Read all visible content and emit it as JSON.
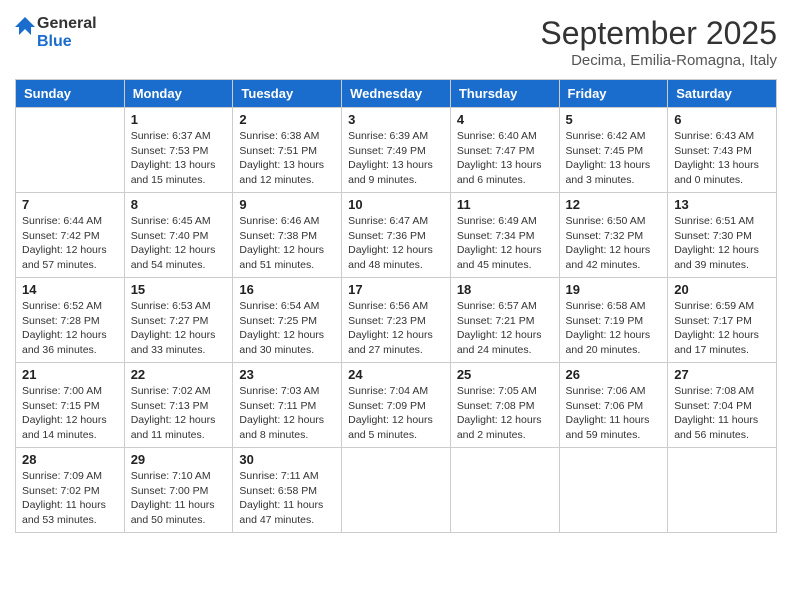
{
  "header": {
    "logo_line1": "General",
    "logo_line2": "Blue",
    "title": "September 2025",
    "subtitle": "Decima, Emilia-Romagna, Italy"
  },
  "days_of_week": [
    "Sunday",
    "Monday",
    "Tuesday",
    "Wednesday",
    "Thursday",
    "Friday",
    "Saturday"
  ],
  "weeks": [
    [
      {
        "day": "",
        "lines": []
      },
      {
        "day": "1",
        "lines": [
          "Sunrise: 6:37 AM",
          "Sunset: 7:53 PM",
          "Daylight: 13 hours",
          "and 15 minutes."
        ]
      },
      {
        "day": "2",
        "lines": [
          "Sunrise: 6:38 AM",
          "Sunset: 7:51 PM",
          "Daylight: 13 hours",
          "and 12 minutes."
        ]
      },
      {
        "day": "3",
        "lines": [
          "Sunrise: 6:39 AM",
          "Sunset: 7:49 PM",
          "Daylight: 13 hours",
          "and 9 minutes."
        ]
      },
      {
        "day": "4",
        "lines": [
          "Sunrise: 6:40 AM",
          "Sunset: 7:47 PM",
          "Daylight: 13 hours",
          "and 6 minutes."
        ]
      },
      {
        "day": "5",
        "lines": [
          "Sunrise: 6:42 AM",
          "Sunset: 7:45 PM",
          "Daylight: 13 hours",
          "and 3 minutes."
        ]
      },
      {
        "day": "6",
        "lines": [
          "Sunrise: 6:43 AM",
          "Sunset: 7:43 PM",
          "Daylight: 13 hours",
          "and 0 minutes."
        ]
      }
    ],
    [
      {
        "day": "7",
        "lines": [
          "Sunrise: 6:44 AM",
          "Sunset: 7:42 PM",
          "Daylight: 12 hours",
          "and 57 minutes."
        ]
      },
      {
        "day": "8",
        "lines": [
          "Sunrise: 6:45 AM",
          "Sunset: 7:40 PM",
          "Daylight: 12 hours",
          "and 54 minutes."
        ]
      },
      {
        "day": "9",
        "lines": [
          "Sunrise: 6:46 AM",
          "Sunset: 7:38 PM",
          "Daylight: 12 hours",
          "and 51 minutes."
        ]
      },
      {
        "day": "10",
        "lines": [
          "Sunrise: 6:47 AM",
          "Sunset: 7:36 PM",
          "Daylight: 12 hours",
          "and 48 minutes."
        ]
      },
      {
        "day": "11",
        "lines": [
          "Sunrise: 6:49 AM",
          "Sunset: 7:34 PM",
          "Daylight: 12 hours",
          "and 45 minutes."
        ]
      },
      {
        "day": "12",
        "lines": [
          "Sunrise: 6:50 AM",
          "Sunset: 7:32 PM",
          "Daylight: 12 hours",
          "and 42 minutes."
        ]
      },
      {
        "day": "13",
        "lines": [
          "Sunrise: 6:51 AM",
          "Sunset: 7:30 PM",
          "Daylight: 12 hours",
          "and 39 minutes."
        ]
      }
    ],
    [
      {
        "day": "14",
        "lines": [
          "Sunrise: 6:52 AM",
          "Sunset: 7:28 PM",
          "Daylight: 12 hours",
          "and 36 minutes."
        ]
      },
      {
        "day": "15",
        "lines": [
          "Sunrise: 6:53 AM",
          "Sunset: 7:27 PM",
          "Daylight: 12 hours",
          "and 33 minutes."
        ]
      },
      {
        "day": "16",
        "lines": [
          "Sunrise: 6:54 AM",
          "Sunset: 7:25 PM",
          "Daylight: 12 hours",
          "and 30 minutes."
        ]
      },
      {
        "day": "17",
        "lines": [
          "Sunrise: 6:56 AM",
          "Sunset: 7:23 PM",
          "Daylight: 12 hours",
          "and 27 minutes."
        ]
      },
      {
        "day": "18",
        "lines": [
          "Sunrise: 6:57 AM",
          "Sunset: 7:21 PM",
          "Daylight: 12 hours",
          "and 24 minutes."
        ]
      },
      {
        "day": "19",
        "lines": [
          "Sunrise: 6:58 AM",
          "Sunset: 7:19 PM",
          "Daylight: 12 hours",
          "and 20 minutes."
        ]
      },
      {
        "day": "20",
        "lines": [
          "Sunrise: 6:59 AM",
          "Sunset: 7:17 PM",
          "Daylight: 12 hours",
          "and 17 minutes."
        ]
      }
    ],
    [
      {
        "day": "21",
        "lines": [
          "Sunrise: 7:00 AM",
          "Sunset: 7:15 PM",
          "Daylight: 12 hours",
          "and 14 minutes."
        ]
      },
      {
        "day": "22",
        "lines": [
          "Sunrise: 7:02 AM",
          "Sunset: 7:13 PM",
          "Daylight: 12 hours",
          "and 11 minutes."
        ]
      },
      {
        "day": "23",
        "lines": [
          "Sunrise: 7:03 AM",
          "Sunset: 7:11 PM",
          "Daylight: 12 hours",
          "and 8 minutes."
        ]
      },
      {
        "day": "24",
        "lines": [
          "Sunrise: 7:04 AM",
          "Sunset: 7:09 PM",
          "Daylight: 12 hours",
          "and 5 minutes."
        ]
      },
      {
        "day": "25",
        "lines": [
          "Sunrise: 7:05 AM",
          "Sunset: 7:08 PM",
          "Daylight: 12 hours",
          "and 2 minutes."
        ]
      },
      {
        "day": "26",
        "lines": [
          "Sunrise: 7:06 AM",
          "Sunset: 7:06 PM",
          "Daylight: 11 hours",
          "and 59 minutes."
        ]
      },
      {
        "day": "27",
        "lines": [
          "Sunrise: 7:08 AM",
          "Sunset: 7:04 PM",
          "Daylight: 11 hours",
          "and 56 minutes."
        ]
      }
    ],
    [
      {
        "day": "28",
        "lines": [
          "Sunrise: 7:09 AM",
          "Sunset: 7:02 PM",
          "Daylight: 11 hours",
          "and 53 minutes."
        ]
      },
      {
        "day": "29",
        "lines": [
          "Sunrise: 7:10 AM",
          "Sunset: 7:00 PM",
          "Daylight: 11 hours",
          "and 50 minutes."
        ]
      },
      {
        "day": "30",
        "lines": [
          "Sunrise: 7:11 AM",
          "Sunset: 6:58 PM",
          "Daylight: 11 hours",
          "and 47 minutes."
        ]
      },
      {
        "day": "",
        "lines": []
      },
      {
        "day": "",
        "lines": []
      },
      {
        "day": "",
        "lines": []
      },
      {
        "day": "",
        "lines": []
      }
    ]
  ]
}
